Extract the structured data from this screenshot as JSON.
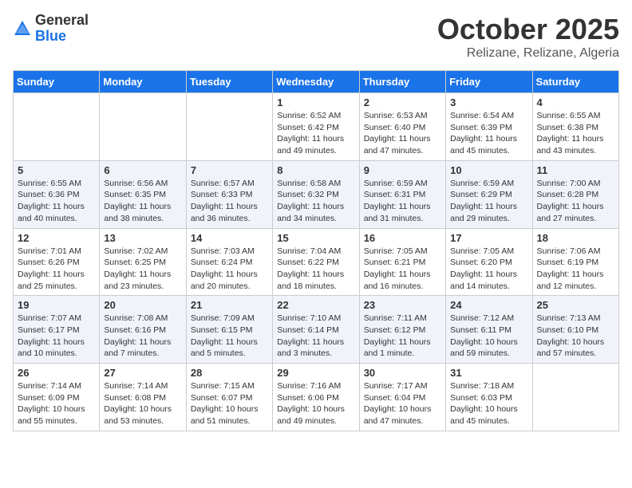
{
  "logo": {
    "general": "General",
    "blue": "Blue"
  },
  "title": "October 2025",
  "subtitle": "Relizane, Relizane, Algeria",
  "weekdays": [
    "Sunday",
    "Monday",
    "Tuesday",
    "Wednesday",
    "Thursday",
    "Friday",
    "Saturday"
  ],
  "rows": [
    [
      {
        "day": "",
        "info": ""
      },
      {
        "day": "",
        "info": ""
      },
      {
        "day": "",
        "info": ""
      },
      {
        "day": "1",
        "info": "Sunrise: 6:52 AM\nSunset: 6:42 PM\nDaylight: 11 hours and 49 minutes."
      },
      {
        "day": "2",
        "info": "Sunrise: 6:53 AM\nSunset: 6:40 PM\nDaylight: 11 hours and 47 minutes."
      },
      {
        "day": "3",
        "info": "Sunrise: 6:54 AM\nSunset: 6:39 PM\nDaylight: 11 hours and 45 minutes."
      },
      {
        "day": "4",
        "info": "Sunrise: 6:55 AM\nSunset: 6:38 PM\nDaylight: 11 hours and 43 minutes."
      }
    ],
    [
      {
        "day": "5",
        "info": "Sunrise: 6:55 AM\nSunset: 6:36 PM\nDaylight: 11 hours and 40 minutes."
      },
      {
        "day": "6",
        "info": "Sunrise: 6:56 AM\nSunset: 6:35 PM\nDaylight: 11 hours and 38 minutes."
      },
      {
        "day": "7",
        "info": "Sunrise: 6:57 AM\nSunset: 6:33 PM\nDaylight: 11 hours and 36 minutes."
      },
      {
        "day": "8",
        "info": "Sunrise: 6:58 AM\nSunset: 6:32 PM\nDaylight: 11 hours and 34 minutes."
      },
      {
        "day": "9",
        "info": "Sunrise: 6:59 AM\nSunset: 6:31 PM\nDaylight: 11 hours and 31 minutes."
      },
      {
        "day": "10",
        "info": "Sunrise: 6:59 AM\nSunset: 6:29 PM\nDaylight: 11 hours and 29 minutes."
      },
      {
        "day": "11",
        "info": "Sunrise: 7:00 AM\nSunset: 6:28 PM\nDaylight: 11 hours and 27 minutes."
      }
    ],
    [
      {
        "day": "12",
        "info": "Sunrise: 7:01 AM\nSunset: 6:26 PM\nDaylight: 11 hours and 25 minutes."
      },
      {
        "day": "13",
        "info": "Sunrise: 7:02 AM\nSunset: 6:25 PM\nDaylight: 11 hours and 23 minutes."
      },
      {
        "day": "14",
        "info": "Sunrise: 7:03 AM\nSunset: 6:24 PM\nDaylight: 11 hours and 20 minutes."
      },
      {
        "day": "15",
        "info": "Sunrise: 7:04 AM\nSunset: 6:22 PM\nDaylight: 11 hours and 18 minutes."
      },
      {
        "day": "16",
        "info": "Sunrise: 7:05 AM\nSunset: 6:21 PM\nDaylight: 11 hours and 16 minutes."
      },
      {
        "day": "17",
        "info": "Sunrise: 7:05 AM\nSunset: 6:20 PM\nDaylight: 11 hours and 14 minutes."
      },
      {
        "day": "18",
        "info": "Sunrise: 7:06 AM\nSunset: 6:19 PM\nDaylight: 11 hours and 12 minutes."
      }
    ],
    [
      {
        "day": "19",
        "info": "Sunrise: 7:07 AM\nSunset: 6:17 PM\nDaylight: 11 hours and 10 minutes."
      },
      {
        "day": "20",
        "info": "Sunrise: 7:08 AM\nSunset: 6:16 PM\nDaylight: 11 hours and 7 minutes."
      },
      {
        "day": "21",
        "info": "Sunrise: 7:09 AM\nSunset: 6:15 PM\nDaylight: 11 hours and 5 minutes."
      },
      {
        "day": "22",
        "info": "Sunrise: 7:10 AM\nSunset: 6:14 PM\nDaylight: 11 hours and 3 minutes."
      },
      {
        "day": "23",
        "info": "Sunrise: 7:11 AM\nSunset: 6:12 PM\nDaylight: 11 hours and 1 minute."
      },
      {
        "day": "24",
        "info": "Sunrise: 7:12 AM\nSunset: 6:11 PM\nDaylight: 10 hours and 59 minutes."
      },
      {
        "day": "25",
        "info": "Sunrise: 7:13 AM\nSunset: 6:10 PM\nDaylight: 10 hours and 57 minutes."
      }
    ],
    [
      {
        "day": "26",
        "info": "Sunrise: 7:14 AM\nSunset: 6:09 PM\nDaylight: 10 hours and 55 minutes."
      },
      {
        "day": "27",
        "info": "Sunrise: 7:14 AM\nSunset: 6:08 PM\nDaylight: 10 hours and 53 minutes."
      },
      {
        "day": "28",
        "info": "Sunrise: 7:15 AM\nSunset: 6:07 PM\nDaylight: 10 hours and 51 minutes."
      },
      {
        "day": "29",
        "info": "Sunrise: 7:16 AM\nSunset: 6:06 PM\nDaylight: 10 hours and 49 minutes."
      },
      {
        "day": "30",
        "info": "Sunrise: 7:17 AM\nSunset: 6:04 PM\nDaylight: 10 hours and 47 minutes."
      },
      {
        "day": "31",
        "info": "Sunrise: 7:18 AM\nSunset: 6:03 PM\nDaylight: 10 hours and 45 minutes."
      },
      {
        "day": "",
        "info": ""
      }
    ]
  ]
}
